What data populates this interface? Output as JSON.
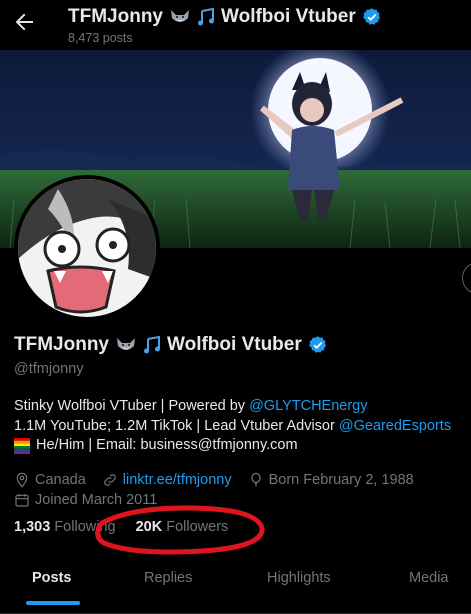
{
  "header": {
    "title": "TFMJonny",
    "title_suffix": "Wolfboi Vtuber",
    "posts_count": "8,473 posts"
  },
  "profile": {
    "display_name": "TFMJonny",
    "display_suffix": "Wolfboi Vtuber",
    "handle": "@tfmjonny",
    "bio": {
      "line1_text": "Stinky Wolfboi VTuber | Powered by ",
      "line1_link": "@GLYTCHEnergy",
      "line2_text": "1.1M YouTube; 1.2M TikTok | Lead Vtuber Advisor ",
      "line2_link": "@GearedEsports",
      "line3_text": "He/Him | Email: business@tfmjonny.com"
    },
    "location": "Canada",
    "website": "linktr.ee/tfmjonny",
    "birthday": "Born February 2, 1988",
    "joined": "Joined March 2011",
    "following_count": "1,303",
    "following_label": "Following",
    "followers_count": "20K",
    "followers_label": "Followers"
  },
  "tabs": [
    "Posts",
    "Replies",
    "Highlights",
    "Media"
  ],
  "active_tab": "Posts",
  "colors": {
    "accent": "#1d9bf0",
    "annotation": "#e0141e",
    "background": "#000000",
    "muted": "#71767b"
  },
  "icons": [
    "back-arrow-icon",
    "wolf-emoji-icon",
    "music-notes-icon",
    "verified-badge-icon",
    "location-pin-icon",
    "link-icon",
    "balloon-icon",
    "calendar-icon"
  ]
}
